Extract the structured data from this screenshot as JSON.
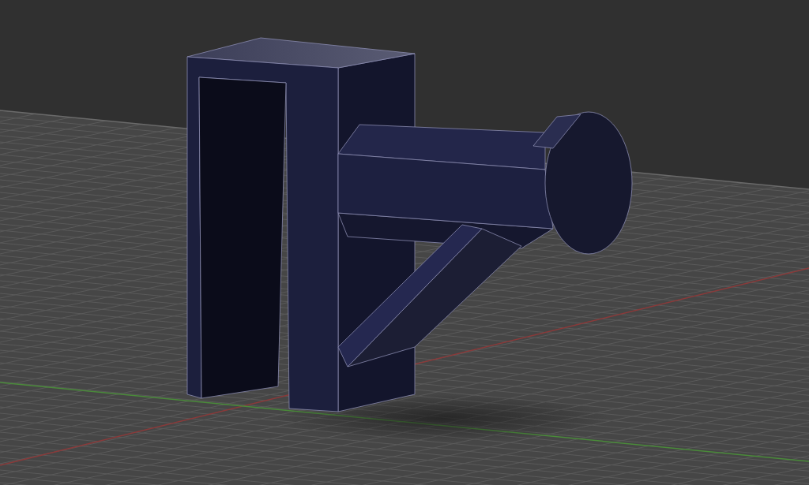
{
  "viewport": {
    "show_grid": true,
    "show_axes": true,
    "show_model": true
  }
}
